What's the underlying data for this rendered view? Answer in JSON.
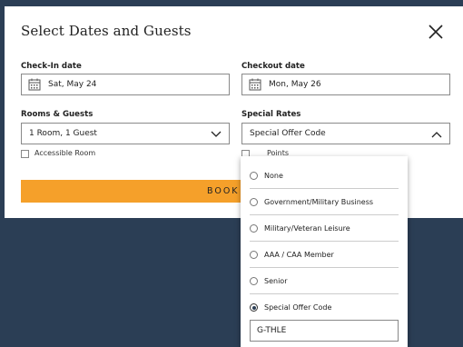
{
  "modal": {
    "title": "Select Dates and Guests"
  },
  "checkin": {
    "label": "Check-In date",
    "value": "Sat, May 24"
  },
  "checkout": {
    "label": "Checkout date",
    "value": "Mon, May 26"
  },
  "rooms": {
    "label": "Rooms & Guests",
    "value": "1 Room, 1 Guest"
  },
  "rates": {
    "label": "Special Rates",
    "value": "Special Offer Code"
  },
  "accessible": {
    "label": "Accessible Room",
    "checked": false
  },
  "points": {
    "label_visible": "Points",
    "checked": false
  },
  "book": {
    "label_visible": "BOOK N"
  },
  "dropdown": {
    "options": [
      {
        "label": "None",
        "selected": false
      },
      {
        "label": "Government/Military Business",
        "selected": false
      },
      {
        "label": "Military/Veteran Leisure",
        "selected": false
      },
      {
        "label": "AAA / CAA Member",
        "selected": false
      },
      {
        "label": "Senior",
        "selected": false
      },
      {
        "label": "Special Offer Code",
        "selected": true
      }
    ],
    "code_value": "G-THLE"
  },
  "colors": {
    "background": "#2b3e55",
    "book_button": "#f5a02a",
    "modal": "#ffffff"
  },
  "icons": [
    "close-icon",
    "calendar-icon",
    "chevron-down-icon",
    "chevron-up-icon"
  ]
}
